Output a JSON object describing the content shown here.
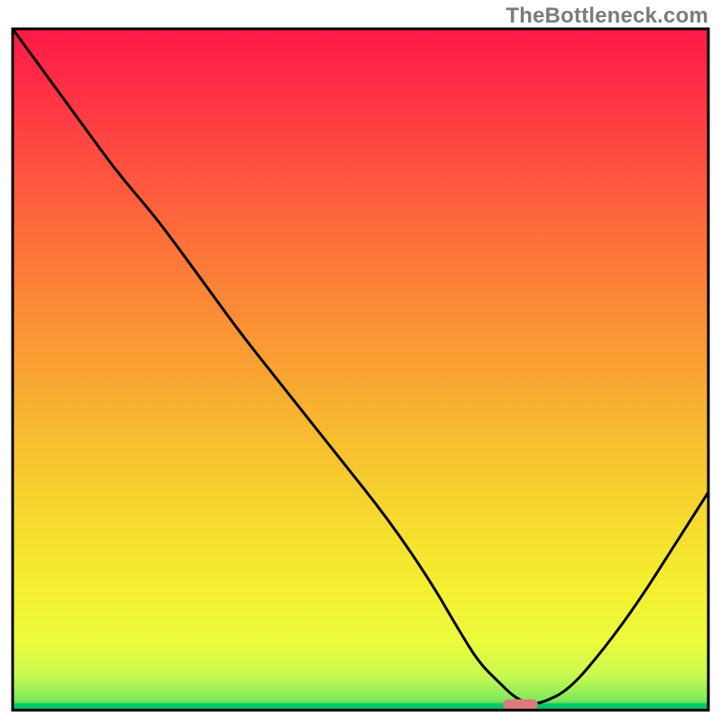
{
  "watermark": "TheBottleneck.com",
  "chart_data": {
    "type": "line",
    "title": "",
    "xlabel": "",
    "ylabel": "",
    "xlim": [
      0,
      100
    ],
    "ylim": [
      0,
      100
    ],
    "grid": false,
    "legend": false,
    "curve": {
      "name": "bottleneck-curve",
      "x": [
        0,
        5,
        10,
        15,
        20,
        23,
        28,
        33,
        40,
        47,
        54,
        60,
        64,
        67,
        70,
        72,
        74,
        76,
        80,
        85,
        90,
        95,
        100
      ],
      "y": [
        100,
        93,
        86,
        79,
        73,
        69,
        62,
        55,
        46,
        37,
        28,
        19,
        12,
        7,
        4,
        2,
        1,
        1,
        3,
        9,
        16,
        24,
        32
      ]
    },
    "bottom_band": {
      "y_start": 0,
      "y_end": 1,
      "color": "#00c864"
    },
    "marker": {
      "x": 73,
      "y": 0.8,
      "width": 5,
      "height": 1.6,
      "color": "#db7a7e"
    },
    "gradient_stops": [
      {
        "offset": 0.0,
        "color": "#ff1947"
      },
      {
        "offset": 0.08,
        "color": "#ff2e46"
      },
      {
        "offset": 0.18,
        "color": "#ff4a41"
      },
      {
        "offset": 0.3,
        "color": "#fd6d3b"
      },
      {
        "offset": 0.45,
        "color": "#fa9634"
      },
      {
        "offset": 0.6,
        "color": "#f7bd2f"
      },
      {
        "offset": 0.72,
        "color": "#f6da2e"
      },
      {
        "offset": 0.82,
        "color": "#f4ef30"
      },
      {
        "offset": 0.9,
        "color": "#ecfb3d"
      },
      {
        "offset": 0.95,
        "color": "#c7f950"
      },
      {
        "offset": 0.985,
        "color": "#7ee95b"
      },
      {
        "offset": 1.0,
        "color": "#00c864"
      }
    ]
  }
}
